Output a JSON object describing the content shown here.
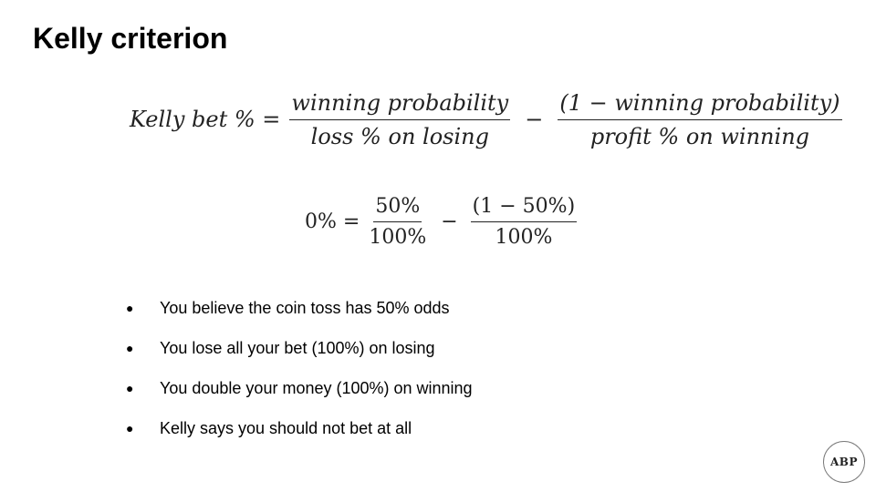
{
  "slide": {
    "title": "Kelly criterion"
  },
  "formula_general": {
    "lhs": "Kelly bet % =",
    "term1_numerator": "winning probability",
    "term1_denominator": "loss % on losing",
    "operator": "−",
    "term2_numerator": "(1 − winning probability)",
    "term2_denominator": "profit % on winning"
  },
  "formula_example": {
    "lhs": "0% =",
    "term1_numerator": "50%",
    "term1_denominator": "100%",
    "operator": "−",
    "term2_numerator": "(1 − 50%)",
    "term2_denominator": "100%"
  },
  "bullets": [
    "You believe the coin toss has 50% odds",
    "You lose all your bet (100%) on losing",
    "You double your money (100%) on winning",
    "Kelly says you should not bet at all"
  ],
  "bullet_glyph": "●",
  "logo": {
    "text": "ABP"
  }
}
